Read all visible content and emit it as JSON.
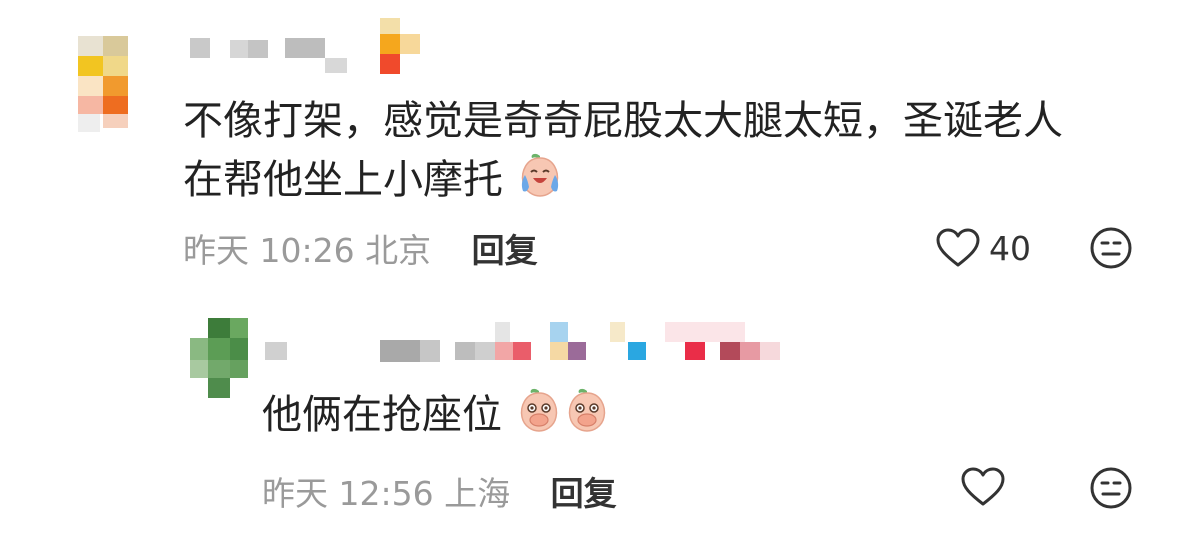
{
  "comments": [
    {
      "text": "不像打架，感觉是奇奇屁股太大腿太短，圣诞老人在帮他坐上小摩托",
      "line1": "不像打架，感觉是奇奇屁股太大腿太短，圣诞老人",
      "line2": "在帮他坐上小摩托",
      "emoji": "crying-laugh-peach",
      "time": "昨天 10:26",
      "location": "北京",
      "reply_label": "回复",
      "like_count": "40"
    },
    {
      "text": "他俩在抢座位",
      "emoji": "peach-face-x2",
      "time": "昨天 12:56",
      "location": "上海",
      "reply_label": "回复",
      "like_count": ""
    }
  ],
  "colors": {
    "text": "#222222",
    "meta": "#9a9a9a",
    "reply": "#333333",
    "peach": "#f7c7b3",
    "leaf": "#6cb36a"
  },
  "icons": [
    "heart-outline-icon",
    "neutral-face-icon",
    "peach-emoji-icon"
  ]
}
